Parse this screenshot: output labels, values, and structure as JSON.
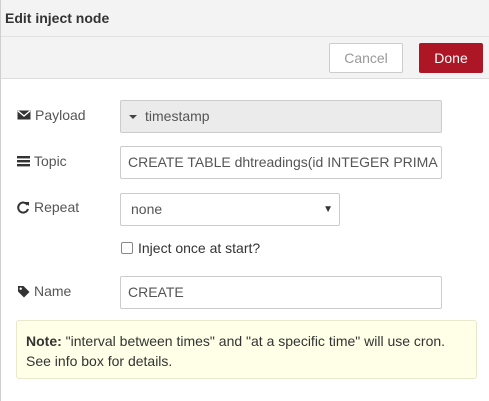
{
  "header": {
    "title": "Edit inject node"
  },
  "toolbar": {
    "cancel_label": "Cancel",
    "done_label": "Done"
  },
  "form": {
    "payload": {
      "label": "Payload",
      "value": "timestamp"
    },
    "topic": {
      "label": "Topic",
      "value": "CREATE TABLE dhtreadings(id INTEGER PRIMA"
    },
    "repeat": {
      "label": "Repeat",
      "value": "none"
    },
    "inject_once": {
      "label": "Inject once at start?",
      "checked": false
    },
    "name": {
      "label": "Name",
      "value": "CREATE"
    }
  },
  "note": {
    "prefix": "Note:",
    "line1": " \"interval between times\" and \"at a specific time\" will use cron.",
    "line2": "See info box for details."
  },
  "colors": {
    "done": "#ad1625",
    "note_bg": "#ffffe8"
  }
}
